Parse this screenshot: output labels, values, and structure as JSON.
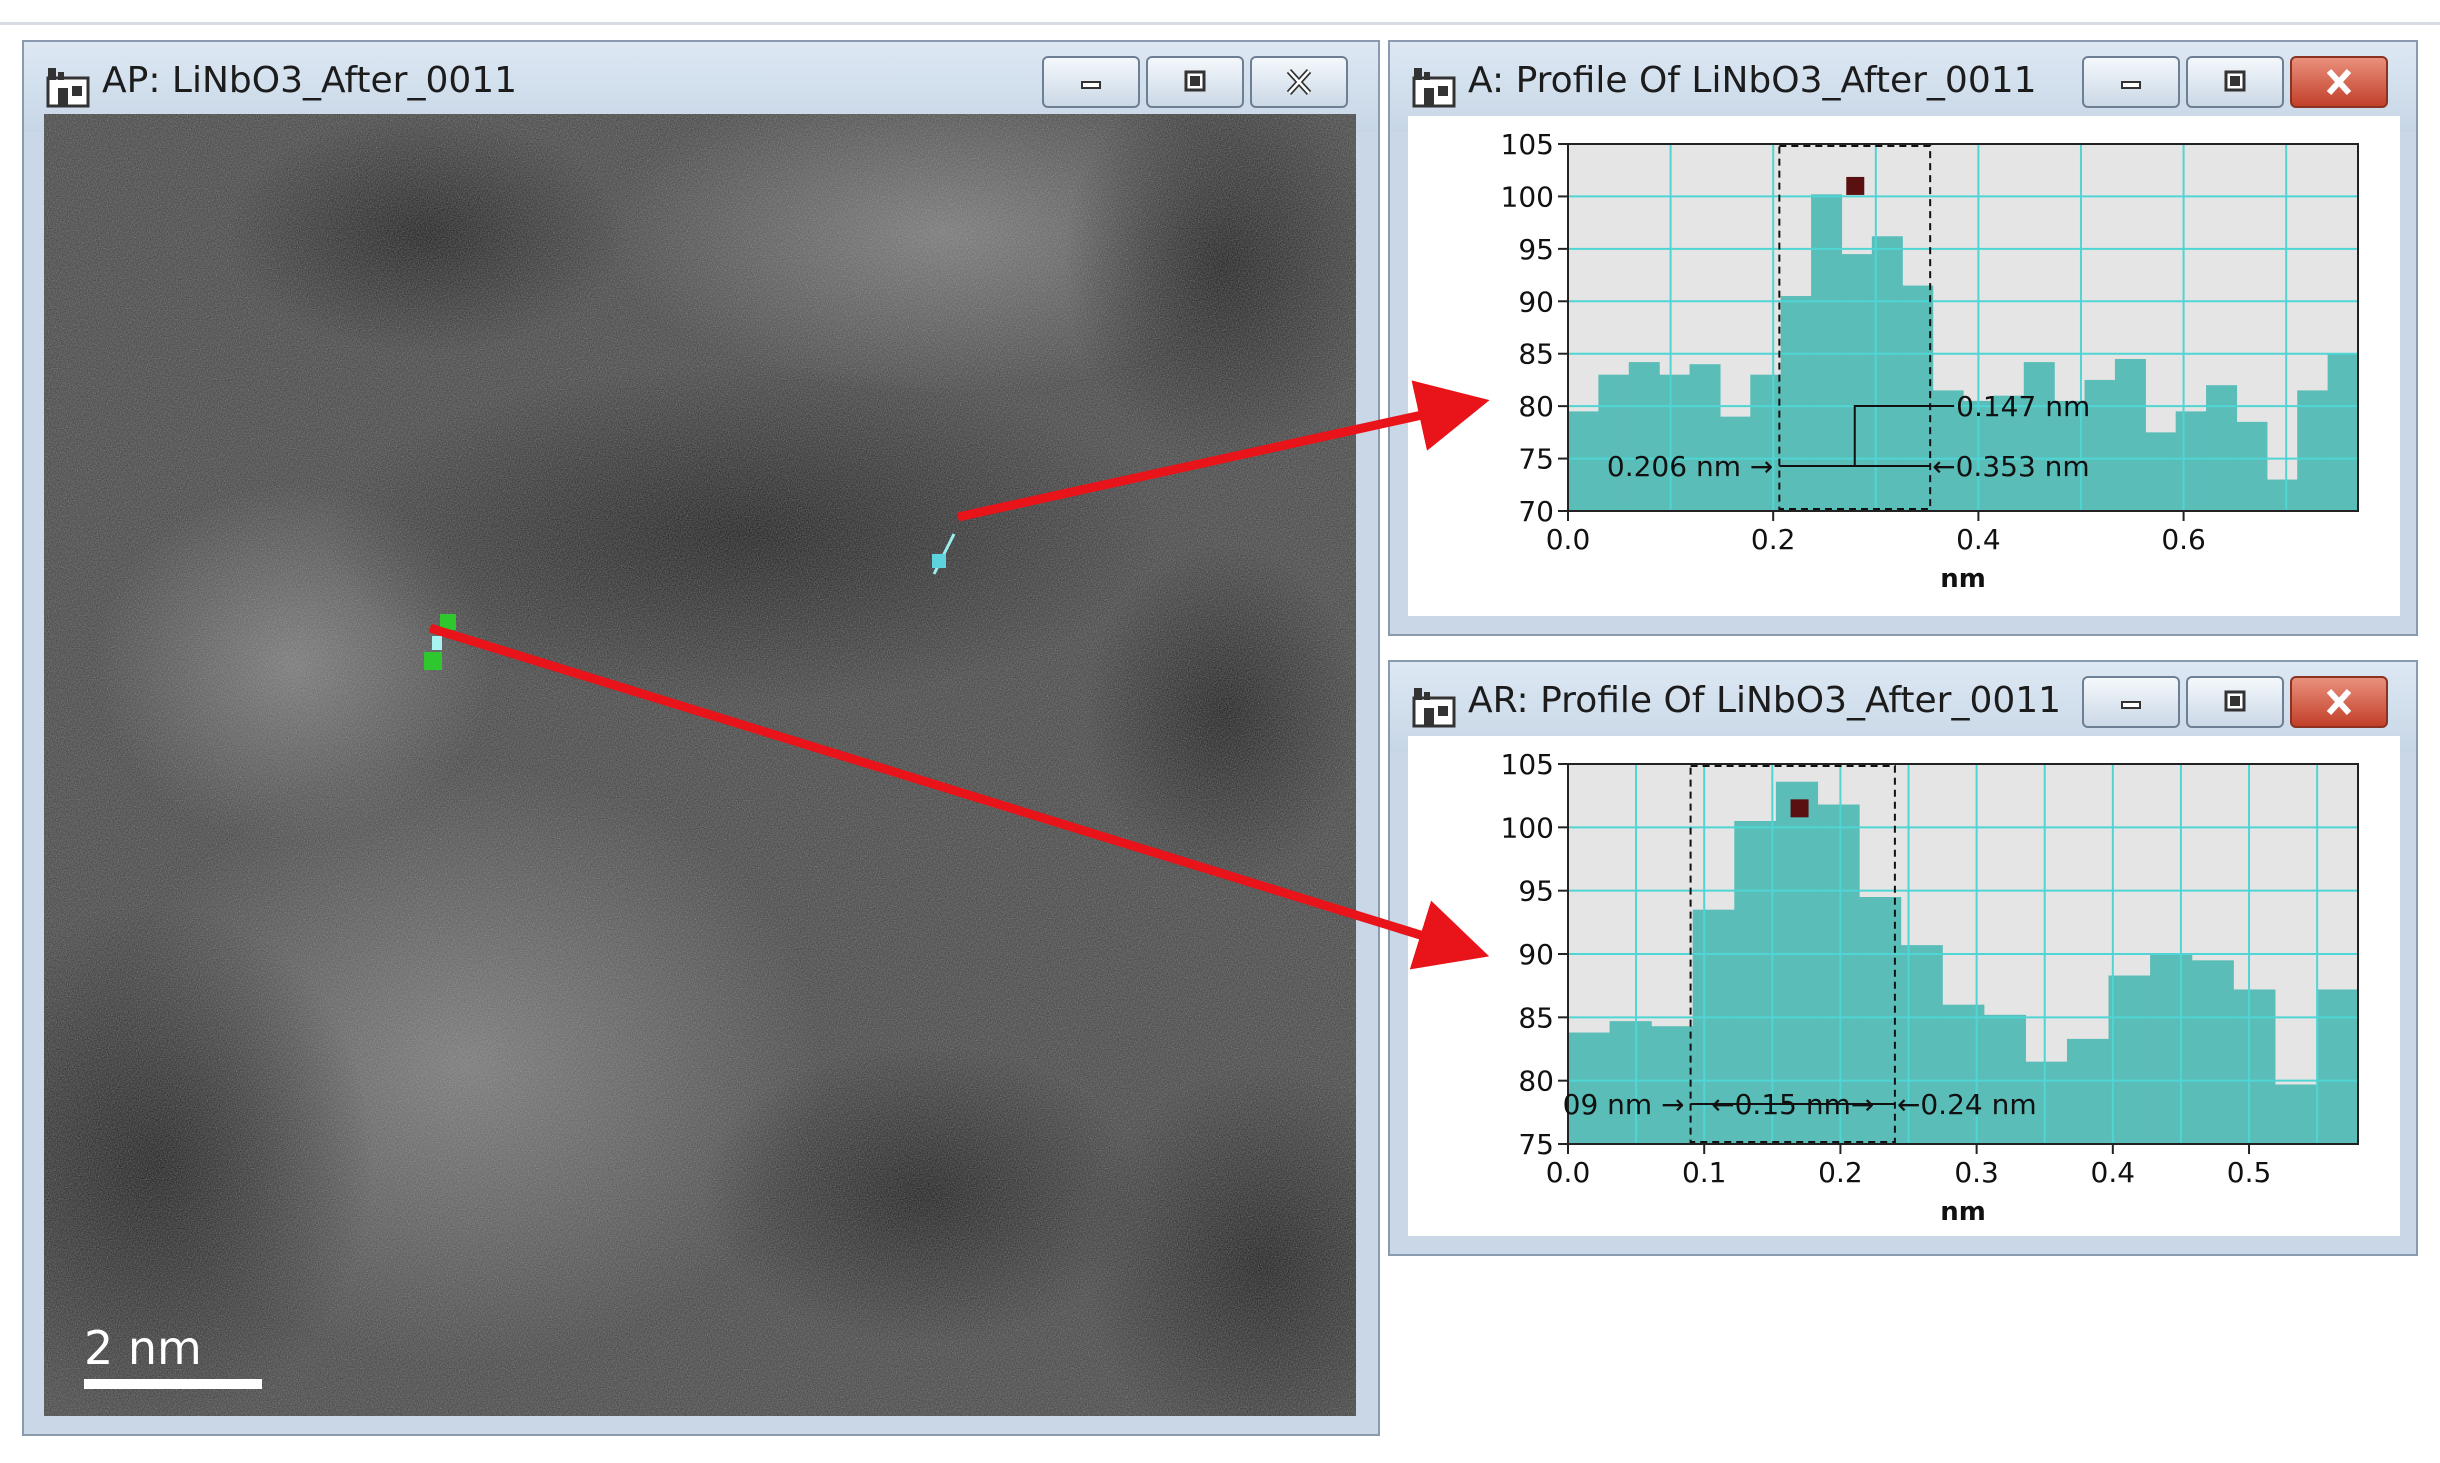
{
  "windows": {
    "image": {
      "title": "AP: LiNbO3_After_0011",
      "scale_bar_label": "2 nm"
    },
    "profile_a": {
      "title": "A: Profile Of LiNbO3_After_0011"
    },
    "profile_ar": {
      "title": "AR: Profile Of LiNbO3_After_0011"
    }
  },
  "colors": {
    "bar_fill": "#5bbdb8",
    "grid": "#4fd5d3",
    "plot_bg": "#e5e5e5",
    "arrow": "#e8141a",
    "marker": "#5a1010"
  },
  "icons": [
    "window-app-icon",
    "minimize-icon",
    "maximize-icon",
    "close-icon"
  ],
  "chart_data": [
    {
      "type": "bar",
      "title": "A: Profile Of LiNbO3_After_0011",
      "xlabel": "nm",
      "ylabel": "",
      "xlim": [
        0.0,
        0.77
      ],
      "ylim": [
        70,
        105
      ],
      "x_ticks": [
        "0.0",
        "0.2",
        "0.4",
        "0.6"
      ],
      "y_ticks": [
        "70",
        "75",
        "80",
        "85",
        "90",
        "95",
        "100",
        "105"
      ],
      "x": [
        0.0,
        0.033,
        0.066,
        0.099,
        0.132,
        0.165,
        0.198,
        0.231,
        0.264,
        0.297,
        0.33,
        0.363,
        0.396,
        0.429,
        0.462,
        0.495,
        0.528,
        0.561,
        0.594,
        0.627,
        0.66,
        0.693,
        0.726
      ],
      "values": [
        79.5,
        83,
        84.2,
        83,
        84,
        79,
        83,
        90.5,
        100.2,
        94.5,
        96.2,
        91.5,
        81.5,
        80.5,
        81,
        84.2,
        80.5,
        82.5,
        84.5,
        77.5,
        79.5,
        82,
        78.5,
        73,
        81.5,
        85
      ],
      "bin_width": 0.0297,
      "selection": {
        "start": 0.206,
        "end": 0.353
      },
      "marker": {
        "x": 0.28,
        "y": 101
      },
      "annotations": [
        "0.147 nm",
        "0.206 nm",
        "0.353 nm"
      ]
    },
    {
      "type": "bar",
      "title": "AR: Profile Of LiNbO3_After_0011",
      "xlabel": "nm",
      "ylabel": "",
      "xlim": [
        0.0,
        0.58
      ],
      "ylim": [
        75,
        105
      ],
      "x_ticks": [
        "0.0",
        "0.1",
        "0.2",
        "0.3",
        "0.4",
        "0.5"
      ],
      "y_ticks": [
        "75",
        "80",
        "85",
        "90",
        "95",
        "100",
        "105"
      ],
      "values": [
        83.8,
        84.7,
        84.3,
        93.5,
        100.5,
        103.6,
        101.8,
        94.5,
        90.7,
        86,
        85.2,
        81.5,
        83.3,
        88.3,
        90,
        89.5,
        87.2,
        79.7,
        87.2
      ],
      "bin_width": 0.0305,
      "selection": {
        "start": 0.09,
        "end": 0.24
      },
      "marker": {
        "x": 0.17,
        "y": 101.5
      },
      "annotations": [
        "09 nm",
        "0.15 nm",
        "0.24 nm"
      ]
    }
  ]
}
